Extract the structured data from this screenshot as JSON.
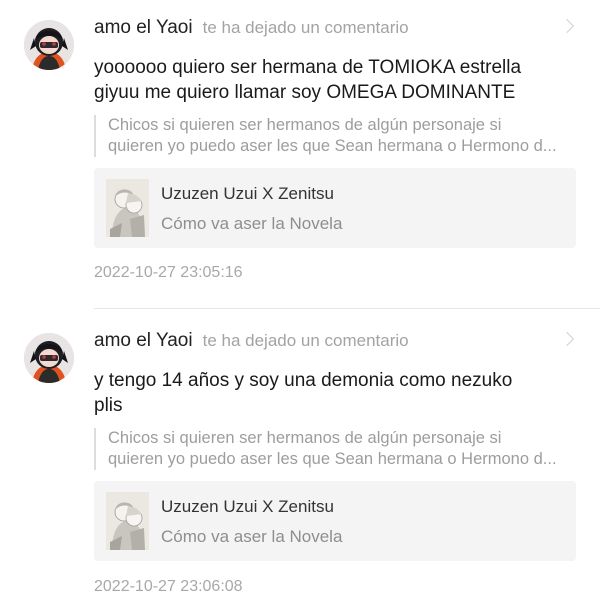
{
  "notifications": [
    {
      "username": "amo el Yaoi",
      "action": "te ha dejado un comentario",
      "comment_lines": [
        "yoooooo quiero ser hermana de TOMIOKA estrella",
        "giyuu me quiero llamar soy OMEGA DOMINANTE"
      ],
      "quote_lines": [
        "Chicos si quieren ser hermanos de algún personaje si",
        "quieren yo puedo aser les que Sean hermana o Hermono d..."
      ],
      "story_title": "Uzuzen Uzui X Zenitsu",
      "story_subtitle": "Cómo va aser la Novela",
      "timestamp": "2022-10-27 23:05:16",
      "avatar_icon": "anime-girl-avatar",
      "chevron_icon": "chevron-right-icon"
    },
    {
      "username": "amo el Yaoi",
      "action": "te ha dejado un comentario",
      "comment_lines": [
        "y tengo 14 años y soy una demonia como nezuko",
        "plis"
      ],
      "quote_lines": [
        "Chicos si quieren ser hermanos de algún personaje si",
        "quieren yo puedo aser les que Sean hermana o Hermono d..."
      ],
      "story_title": "Uzuzen Uzui X Zenitsu",
      "story_subtitle": "Cómo va aser la Novela",
      "timestamp": "2022-10-27 23:06:08",
      "avatar_icon": "anime-girl-avatar",
      "chevron_icon": "chevron-right-icon"
    }
  ],
  "colors": {
    "username": "#222222",
    "meta_text": "#a3a3a3",
    "card_bg": "#f4f4f4",
    "divider": "#e6e6e6"
  }
}
